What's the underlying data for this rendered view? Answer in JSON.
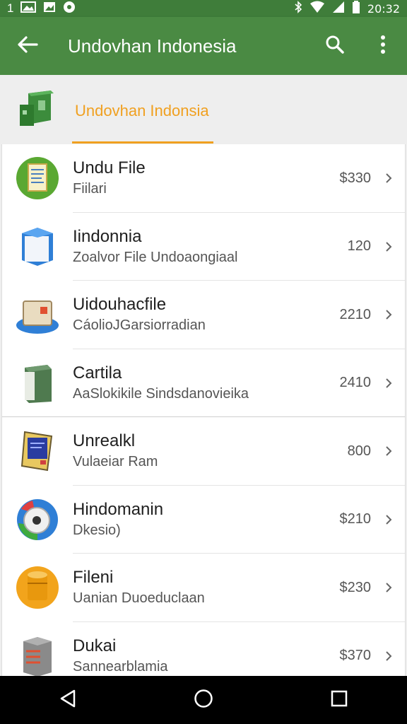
{
  "status": {
    "left_text": "1",
    "time": "20:32"
  },
  "app_bar": {
    "title": "Undovhan Indonesia",
    "back_icon": "back-arrow-icon",
    "search_icon": "search-icon",
    "menu_icon": "more-vert-icon"
  },
  "header": {
    "title": "Undovhan Indonsia",
    "logo_icon": "app-logo-icon",
    "accent": "#f0a020"
  },
  "items": [
    {
      "name": "Undu File",
      "sub": "Fiilari",
      "price": "$330",
      "icon": "document-icon"
    },
    {
      "name": "Iindonnia",
      "sub": "Zoalvor File Undoaongiaal",
      "price": "120",
      "icon": "box-blue-icon"
    },
    {
      "name": "Uidouhacfile",
      "sub": "CáolioJGarsiorradian",
      "price": "2210",
      "icon": "box-tan-icon"
    },
    {
      "name": "Cartila",
      "sub": "AaSlokikile Sindsdanovieika",
      "price": "2410",
      "icon": "book-green-icon"
    },
    {
      "name": "Unrealkl",
      "sub": "Vulaeiar Ram",
      "price": "800",
      "icon": "monitor-icon"
    },
    {
      "name": "Hindomanin",
      "sub": "Dkesio)",
      "price": "$210",
      "icon": "disk-icon"
    },
    {
      "name": "Fileni",
      "sub": "Uanian Duoeduclaan",
      "price": "$230",
      "icon": "database-icon"
    },
    {
      "name": "Dukai",
      "sub": "Sannearblamia",
      "price": "$370",
      "icon": "server-icon"
    }
  ],
  "colors": {
    "app_bar": "#4a8a43",
    "status_bar": "#3f7d3a"
  }
}
